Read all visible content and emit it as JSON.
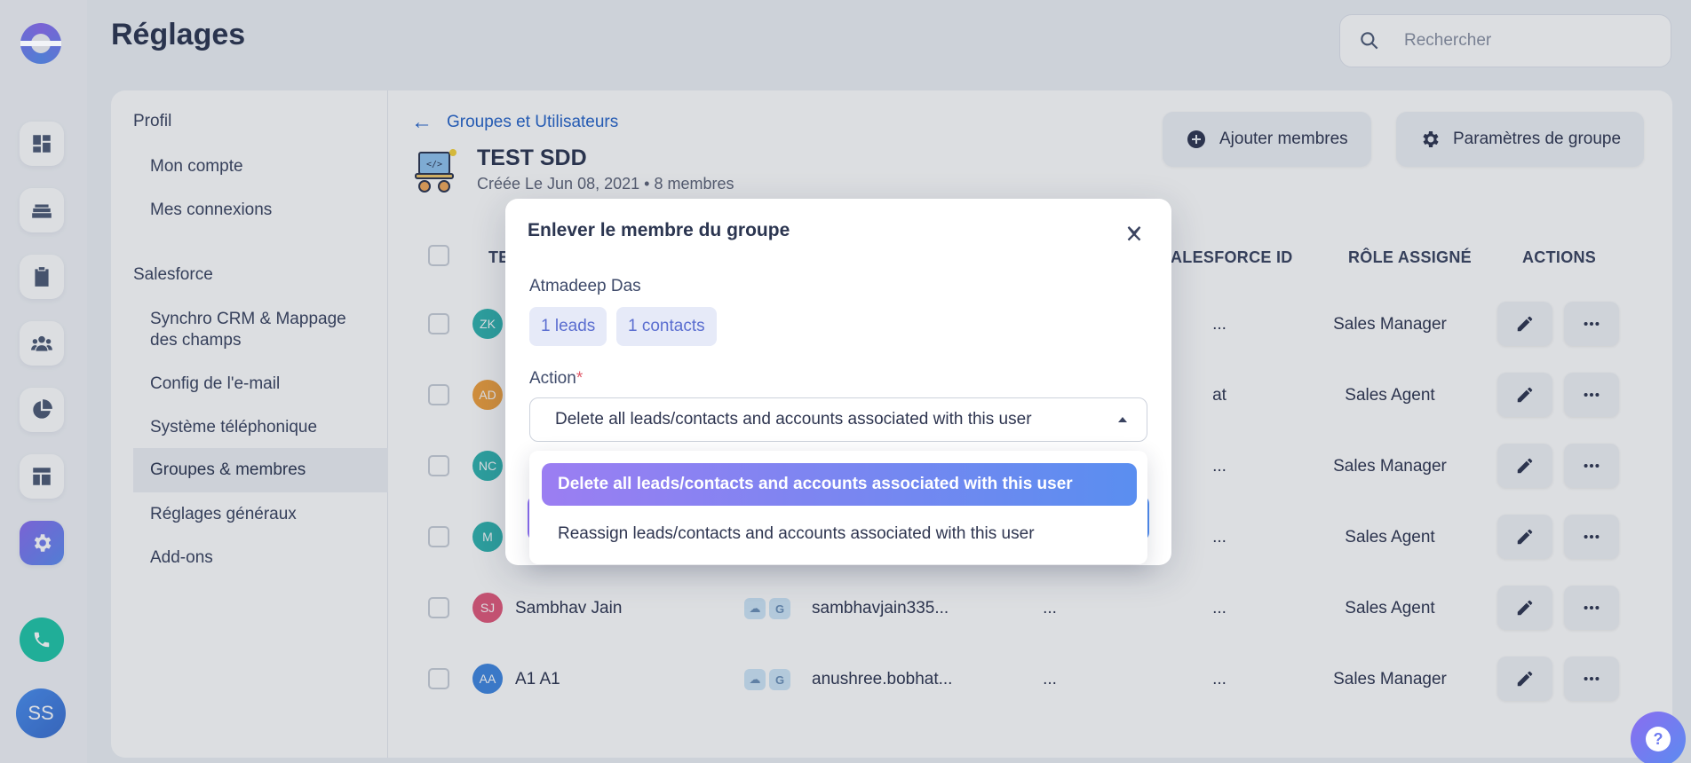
{
  "app": {
    "title": "Réglages"
  },
  "search": {
    "placeholder": "Rechercher"
  },
  "rail": {
    "icons": [
      "dashboard-icon",
      "stack-icon",
      "clipboard-icon",
      "team-icon",
      "pie-chart-icon",
      "layout-icon",
      "settings-icon"
    ],
    "phone_icon": "phone-icon",
    "user_initials": "SS"
  },
  "sidebar": {
    "sections": [
      {
        "title": "Profil",
        "items": [
          "Mon compte",
          "Mes connexions"
        ]
      },
      {
        "title": "Salesforce",
        "items": [
          "Synchro CRM & Mappage des champs",
          "Config de l'e-mail",
          "Système téléphonique",
          "Groupes & membres",
          "Réglages généraux",
          "Add-ons"
        ]
      }
    ],
    "active_item": "Groupes & membres"
  },
  "group": {
    "back_label": "Groupes et Utilisateurs",
    "name": "TEST SDD",
    "created": "Créée Le Jun 08, 2021",
    "members": "8 membres",
    "add_members_label": "Ajouter membres",
    "settings_label": "Paramètres de groupe"
  },
  "table": {
    "headers": {
      "team_partial": "TE",
      "salesforce_id_partial": "ALESFORCE ID",
      "role": "RÔLE ASSIGNÉ",
      "actions": "ACTIONS"
    },
    "rows": [
      {
        "initials": "ZK",
        "color": "#2fb3ae",
        "name": "",
        "email": "",
        "col_a": "",
        "sf_id": "...",
        "role": "Sales Manager"
      },
      {
        "initials": "AD",
        "color": "#f0a03c",
        "name": "",
        "email": "",
        "col_a": "",
        "sf_id": "at",
        "role": "Sales Agent"
      },
      {
        "initials": "NC",
        "color": "#2fb3ae",
        "name": "",
        "email": "",
        "col_a": "",
        "sf_id": "...",
        "role": "Sales Manager"
      },
      {
        "initials": "M",
        "color": "#2fb3ae",
        "name": "",
        "email": "",
        "col_a": "",
        "sf_id": "...",
        "role": "Sales Agent"
      },
      {
        "initials": "SJ",
        "color": "#e0587a",
        "name": "Sambhav Jain",
        "email": "sambhavjain335...",
        "col_a": "...",
        "sf_id": "...",
        "role": "Sales Agent"
      },
      {
        "initials": "AA",
        "color": "#3f86e0",
        "name": "A1 A1",
        "email": "anushree.bobhat...",
        "col_a": "...",
        "sf_id": "...",
        "role": "Sales Manager"
      }
    ]
  },
  "modal": {
    "title": "Enlever le membre du groupe",
    "member_name": "Atmadeep Das",
    "chips": [
      "1 leads",
      "1 contacts"
    ],
    "action_label": "Action",
    "required_mark": "*",
    "selected_value": "Delete all leads/contacts and accounts associated with this user",
    "options": [
      "Delete all leads/contacts and accounts associated with this user",
      "Reassign leads/contacts and accounts associated with this user"
    ]
  },
  "help_glyph": "?",
  "colors": {
    "accent_start": "#8a6df0",
    "accent_end": "#5b8cf0",
    "link": "#2563c9",
    "phone": "#1fc6a8"
  }
}
